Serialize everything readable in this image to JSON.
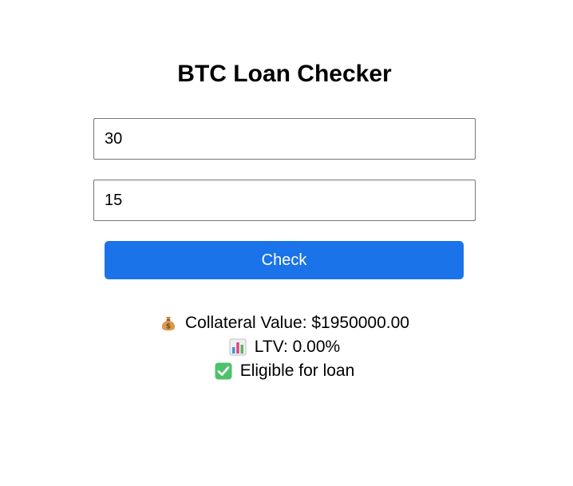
{
  "app": {
    "title": "BTC Loan Checker"
  },
  "form": {
    "field_1_value": "30",
    "field_2_value": "15",
    "check_label": "Check"
  },
  "results": {
    "collateral_text": "Collateral Value: $1950000.00",
    "collateral_icon": "money-bag-icon",
    "ltv_text": "LTV: 0.00%",
    "ltv_icon": "bar-chart-icon",
    "eligibility_text": "Eligible for loan",
    "eligibility_icon": "check-mark-button-icon"
  },
  "colors": {
    "button": "#1a73e8",
    "check_green": "#4cc26a"
  }
}
